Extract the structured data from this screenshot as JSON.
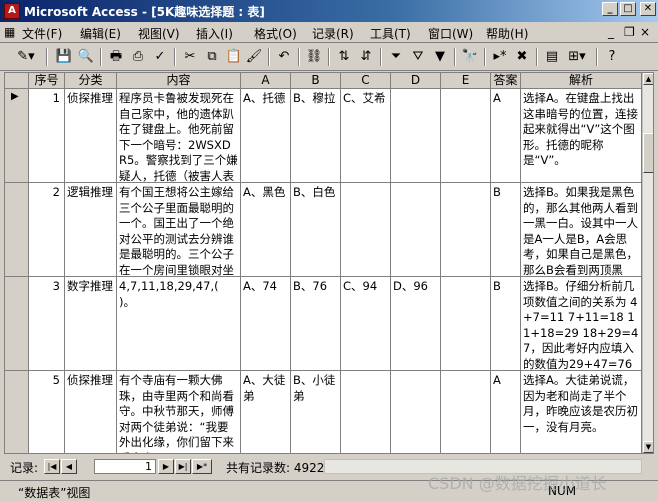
{
  "window": {
    "title": "Microsoft Access - [5K趣味选择题 : 表]",
    "app_icon_text": "A"
  },
  "menu": [
    "文件(F)",
    "编辑(E)",
    "视图(V)",
    "插入(I)",
    "格式(O)",
    "记录(R)",
    "工具(T)",
    "窗口(W)",
    "帮助(H)"
  ],
  "toolbar_icons": [
    "design-view-icon",
    "save-icon",
    "search-file-icon",
    "print-icon",
    "print-preview-icon",
    "spellcheck-icon",
    "cut-icon",
    "copy-icon",
    "paste-icon",
    "format-painter-icon",
    "undo-icon",
    "insert-hyperlink-icon",
    "sort-ascending-icon",
    "sort-descending-icon",
    "filter-by-selection-icon",
    "filter-by-form-icon",
    "apply-filter-icon",
    "find-icon",
    "new-record-icon",
    "delete-record-icon",
    "database-window-icon",
    "new-object-icon",
    "help-icon"
  ],
  "columns": {
    "seq": "序号",
    "category": "分类",
    "content": "内容",
    "a": "A",
    "b": "B",
    "c": "C",
    "d": "D",
    "e": "E",
    "answer": "答案",
    "explanation": "解析"
  },
  "rows": [
    {
      "seq": "1",
      "category": "侦探推理",
      "content": "程序员卡鲁被发现死在自己家中，他的遗体趴在了键盘上。他死前留下一个暗号：2WSXDR5。警察找到了三个嫌疑人，托德（被害人表弟叫地",
      "a": "A、托德",
      "b": "B、穆拉",
      "c": "C、艾希",
      "d": "",
      "e": "",
      "answer": "A",
      "explanation": "选择A。在键盘上找出这串暗号的位置，连接起来就得出“V”这个图形。托德的昵称是“V”。"
    },
    {
      "seq": "2",
      "category": "逻辑推理",
      "content": "有个国王想将公主嫁给三个公子里面最聪明的一个。国王出了一个绝对公平的测试去分辨谁是最聪明的。三个公子在一个房间里锁眼对坐着",
      "a": "A、黑色",
      "b": "B、白色",
      "c": "",
      "d": "",
      "e": "",
      "answer": "B",
      "explanation": "选择B。如果我是黑色的，那么其他两人看到一黑一白。设其中一人是A一人是B，A会思考，如果自己是黑色，那么B会看到两顶黑色，就能马"
    },
    {
      "seq": "3",
      "category": "数字推理",
      "content": "4,7,11,18,29,47,( )。",
      "a": "A、74",
      "b": "B、76",
      "c": "C、94",
      "d": "D、96",
      "e": "",
      "answer": "B",
      "explanation": "选择B。仔细分析前几项数值之间的关系为 4+7=11 7+11=18 11+18=29 18+29=47，因此考好内应填入的数值为29+47=76"
    },
    {
      "seq": "5",
      "category": "侦探推理",
      "content": "有个寺庙有一颗大佛珠，由寺里两个和尚看守。中秋节那天，师傅对两个徒弟说：“我要外出化缘，你们留下来看守寺",
      "a": "A、大徒弟",
      "b": "B、小徒弟",
      "c": "",
      "d": "",
      "e": "",
      "answer": "A",
      "explanation": "选择A。大徒弟说谎，因为老和尚走了半个月，昨晚应该是农历初一，没有月亮。"
    }
  ],
  "navigation": {
    "label": "记录:",
    "current": "1",
    "total_label": "共有记录数: 4922"
  },
  "status": {
    "view": "“数据表”视图",
    "mode": "NUM"
  },
  "watermark": "CSDN @数据挖掘小道长"
}
